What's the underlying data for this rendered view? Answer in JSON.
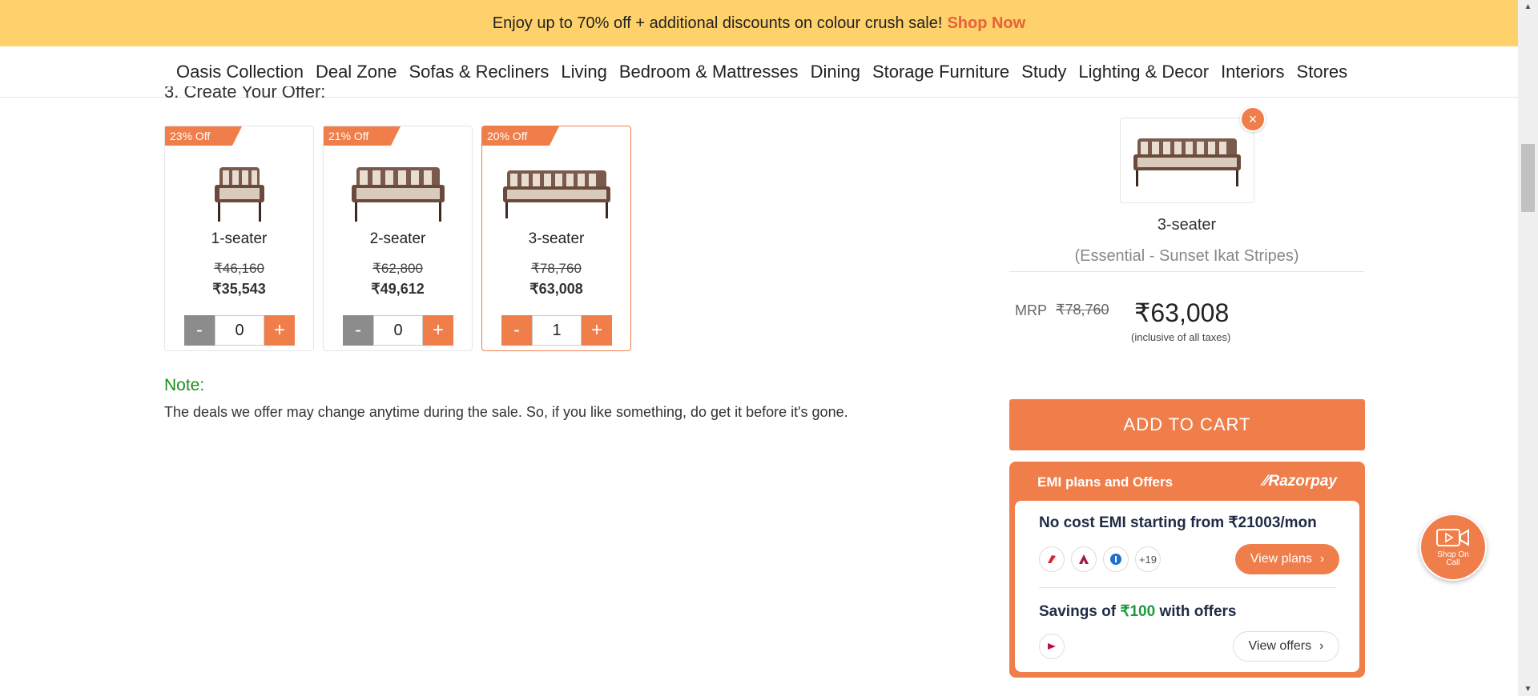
{
  "promo": {
    "text": "Enjoy up to 70% off + additional discounts on colour crush sale!",
    "link": "Shop Now"
  },
  "nav": {
    "items": [
      "Oasis Collection",
      "Deal Zone",
      "Sofas & Recliners",
      "Living",
      "Bedroom & Mattresses",
      "Dining",
      "Storage Furniture",
      "Study",
      "Lighting & Decor",
      "Interiors",
      "Stores"
    ]
  },
  "offer_heading": "3. Create Your Offer:",
  "cards": [
    {
      "badge": "23% Off",
      "name": "1-seater",
      "mrp": "₹46,160",
      "price": "₹35,543",
      "minus": "-",
      "qty": "0",
      "plus": "+"
    },
    {
      "badge": "21% Off",
      "name": "2-seater",
      "mrp": "₹62,800",
      "price": "₹49,612",
      "minus": "-",
      "qty": "0",
      "plus": "+"
    },
    {
      "badge": "20% Off",
      "name": "3-seater",
      "mrp": "₹78,760",
      "price": "₹63,008",
      "minus": "-",
      "qty": "1",
      "plus": "+"
    }
  ],
  "note": {
    "title": "Note:",
    "text": "The deals we offer may change anytime during the sale. So, if you like something, do get it before it's gone."
  },
  "summary": {
    "remove": "×",
    "name": "3-seater",
    "variant": "(Essential - Sunset Ikat Stripes)",
    "mrp_label": "MRP",
    "mrp": "₹78,760",
    "price": "₹63,008",
    "tax_note": "(inclusive of all taxes)"
  },
  "add_to_cart": "ADD TO CART",
  "emi": {
    "title": "EMI plans and Offers",
    "brand": "Razorpay",
    "line1": "No cost EMI starting from ₹21003/mon",
    "more_banks": "+19",
    "view_plans": "View plans",
    "savings_prefix": "Savings of",
    "savings_amount": "₹100",
    "savings_suffix": "with offers",
    "view_offers": "View offers"
  },
  "shop_on_call": "Shop On Call",
  "colors": {
    "accent": "#ef7e4b",
    "promo_bg": "#fed16b",
    "note_green": "#1a8f1a",
    "savings_green": "#1a9c3e"
  }
}
